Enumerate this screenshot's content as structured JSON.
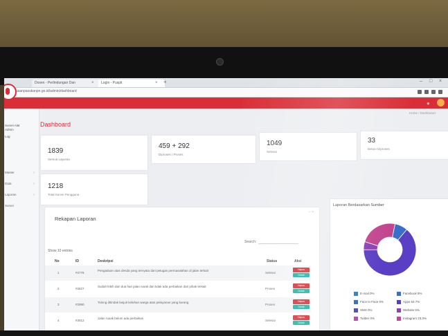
{
  "browser": {
    "tabs": [
      {
        "label": "Dosen - Perlindungan Dan"
      },
      {
        "label": "Login - Puspit"
      }
    ],
    "url": "pelurusanpasukanpn.go.id/admin/dashboard"
  },
  "header": {
    "bell_icon": "bell-icon",
    "avatar_color": "#f6b04a",
    "brand_color": "#d92e37"
  },
  "sidebar": {
    "profile_text": [
      "Survei Alat",
      "Admin",
      "Log"
    ],
    "items": [
      "Master",
      "Data",
      "Laporan",
      "Survei"
    ]
  },
  "page": {
    "title": "Dashboard",
    "breadcrumb": "Home / Dashboard"
  },
  "stats": [
    {
      "value": "1839",
      "label": "Semua Laporan"
    },
    {
      "value": "459 + 292",
      "label": "Diproses / Proses"
    },
    {
      "value": "1049",
      "label": "Selesai"
    },
    {
      "value": "33",
      "label": "Belum Diproses"
    },
    {
      "value": "1218",
      "label": "Total Survei Pengguna"
    }
  ],
  "survey": {
    "title": "Rekapan Laporan",
    "show_label": "Show 10 entries",
    "search_label": "Search:",
    "columns": [
      "No",
      "ID",
      "Deskripsi",
      "Status",
      "Aksi"
    ],
    "rows": [
      {
        "no": "1",
        "id": "#2776",
        "desc": "Pengaduan atas denda yang ternyata dari petugas permasalahan di jalan terkait",
        "status": "Selesai",
        "btn1": "Hapus",
        "btn2": "Detail"
      },
      {
        "no": "2",
        "id": "#2827",
        "desc": "Sudah lebih dari dua hari jalan rusak dan tidak ada perbaikan dari pihak terkait",
        "status": "Proses",
        "btn1": "Hapus",
        "btn2": "Detail"
      },
      {
        "no": "3",
        "id": "#2990",
        "desc": "Tolong ditindak lanjuti keluhan warga atas pelayanan yang kurang",
        "status": "Proses",
        "btn1": "Hapus",
        "btn2": "Detail"
      },
      {
        "no": "4",
        "id": "#3012",
        "desc": "Jalan rusak belum ada perbaikan",
        "status": "Selesai",
        "btn1": "Hapus",
        "btn2": "Detail"
      }
    ]
  },
  "chart_data": {
    "type": "pie",
    "title": "Laporan Berdasarkan Sumber",
    "categories": [
      "E-mail",
      "Facebook",
      "Face to Face",
      "Apps",
      "SMS",
      "Website",
      "Twitter",
      "Instagram"
    ],
    "values": [
      0,
      8,
      0,
      63.7,
      0,
      5,
      0,
      23.3
    ],
    "value_labels": [
      "0%",
      "8%",
      "0%",
      "63.7%",
      "0%",
      "5%",
      "0%",
      "23.3%"
    ],
    "colors": [
      "#2a7fc2",
      "#3a6fc9",
      "#2f6fb3",
      "#5a3ec4",
      "#4a4ab0",
      "#8b3fb0",
      "#b04aa6",
      "#c2458f"
    ]
  }
}
